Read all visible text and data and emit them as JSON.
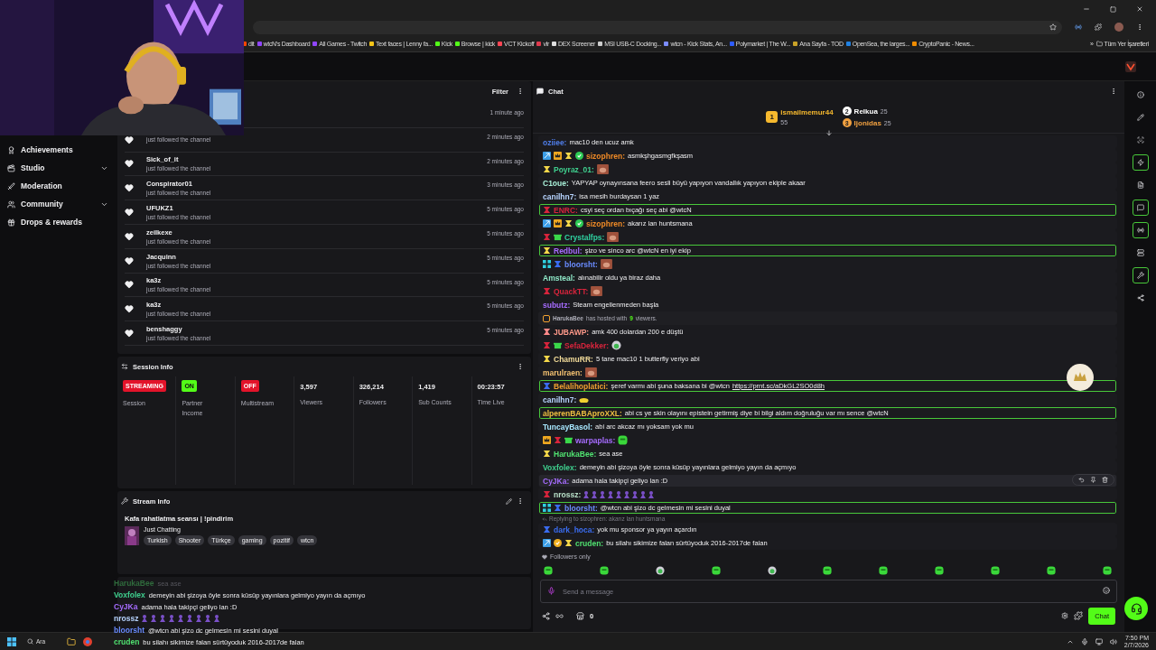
{
  "bookmarks": [
    {
      "label": "dit",
      "color": "#ff4500"
    },
    {
      "label": "wtcN's Dashboard",
      "color": "#9146ff"
    },
    {
      "label": "All Games - Twitch",
      "color": "#9146ff"
    },
    {
      "label": "Text faces | Lenny fa...",
      "color": "#f5c518"
    },
    {
      "label": "Kick",
      "color": "#53fc18"
    },
    {
      "label": "Browse | kick",
      "color": "#53fc18"
    },
    {
      "label": "VCT Kickoff",
      "color": "#ff4655"
    },
    {
      "label": "vlr",
      "color": "#e03a4e"
    },
    {
      "label": "DEX Screener",
      "color": "#dddddd"
    },
    {
      "label": "MSI USB-C Docking...",
      "color": "#cccccc"
    },
    {
      "label": "wtcn - Kick Stats, An...",
      "color": "#7b8cff"
    },
    {
      "label": "Polymarket | The W...",
      "color": "#2e5cff"
    },
    {
      "label": "Ana Sayfa - TOD",
      "color": "#c9a227"
    },
    {
      "label": "OpenSea, the larges...",
      "color": "#2081e2"
    },
    {
      "label": "CryptoPanic - News...",
      "color": "#f08c00"
    }
  ],
  "bookmarks_more": "»",
  "all_bookmarks": "Tüm Yer İşaretleri",
  "sidebar": [
    {
      "label": "Achievements",
      "expandable": false,
      "kind": "trophy"
    },
    {
      "label": "Studio",
      "expandable": true,
      "kind": "studio"
    },
    {
      "label": "Moderation",
      "expandable": false,
      "kind": "sword"
    },
    {
      "label": "Community",
      "expandable": true,
      "kind": "people"
    },
    {
      "label": "Drops & rewards",
      "expandable": false,
      "kind": "gift"
    }
  ],
  "activity": {
    "filter": "Filter",
    "rows": [
      {
        "time": "1 minute ago"
      },
      {
        "text": "just followed the channel",
        "time": "2 minutes ago"
      },
      {
        "name": "Sick_of_it",
        "text": "just followed the channel",
        "time": "2 minutes ago"
      },
      {
        "name": "Conspirator01",
        "text": "just followed the channel",
        "time": "3 minutes ago"
      },
      {
        "name": "UFUKZ1",
        "text": "just followed the channel",
        "time": "5 minutes ago"
      },
      {
        "name": "zeilkexe",
        "text": "just followed the channel",
        "time": "5 minutes ago"
      },
      {
        "name": "Jacquinn",
        "text": "just followed the channel",
        "time": "5 minutes ago"
      },
      {
        "name": "ka3z",
        "text": "just followed the channel",
        "time": "5 minutes ago"
      },
      {
        "name": "ka3z",
        "text": "just followed the channel",
        "time": "5 minutes ago"
      },
      {
        "name": "benshaggy",
        "text": "just followed the channel",
        "time": "5 minutes ago"
      }
    ]
  },
  "session_info": {
    "title": "Session Info",
    "stats": [
      {
        "kind": "status",
        "badge": "STREAMING",
        "color": "#e3132a",
        "label": "Session"
      },
      {
        "kind": "status",
        "badge": "ON",
        "color": "#53fc18",
        "label": "Partner Income"
      },
      {
        "kind": "status",
        "badge": "OFF",
        "color": "#e3132a",
        "label": "Multistream"
      },
      {
        "kind": "number",
        "value": "3,597",
        "label": "Viewers"
      },
      {
        "kind": "number",
        "value": "326,214",
        "label": "Followers"
      },
      {
        "kind": "number",
        "value": "1,419",
        "label": "Sub Counts"
      },
      {
        "kind": "number",
        "value": "00:23:57",
        "label": "Time Live"
      }
    ]
  },
  "stream_info": {
    "title": "Stream Info",
    "stream_title": "Kafa rahatlatma seansı | !pindirim",
    "category": "Just Chatting",
    "tags": [
      "Turkish",
      "Shooter",
      "Türkçe",
      "gaming",
      "pozitif",
      "wtcn"
    ]
  },
  "overlay_chat": [
    {
      "user": "HarukaBee",
      "text": "sea ase",
      "faded": true,
      "color": "#2f6a3c"
    },
    {
      "user": "Voxfolex",
      "text": "demeyin abi şizoya öyle sonra küsüp yayınlara gelmiyo yayın da açmıyo",
      "faded": false,
      "color": "#3fcf8e"
    },
    {
      "user": "CyJKa",
      "text": "adama hala takipçi geliyo lan :D",
      "faded": false,
      "color": "#a66cff"
    },
    {
      "user": "nrossz",
      "faded": false,
      "color": "#b7d4ff"
    },
    {
      "user": "bloorsht",
      "text": "@wtcn abi şizo dc gelmesin mi sesini duyal",
      "faded": false,
      "color": "#6a8cff"
    },
    {
      "user": "cruden",
      "text": "bu silahı sikimize falan sürtüyoduk 2016-2017de falan",
      "faded": false,
      "color": "#50e070"
    }
  ],
  "chat": {
    "title": "Chat",
    "leaders": [
      {
        "rank": "1",
        "name": "ismailmemur44",
        "count": "55",
        "color": "#f5b82e"
      },
      {
        "rank": "2",
        "name": "Relkua",
        "count": "25",
        "color": "#ffffff"
      },
      {
        "rank": "3",
        "name": "Ijonidas",
        "count": "25",
        "color": "#f0a040"
      }
    ],
    "messages": [
      {
        "kind": "text",
        "user": "oziiee:",
        "color": "#4f7de8",
        "text": "mac10 den ucuz amk",
        "highlighted": false,
        "hovered": false
      },
      {
        "kind": "text",
        "user": "sizophren:",
        "color": "#ef8a26",
        "text": "asmkşhgasmgfkşasm",
        "highlighted": false,
        "hovered": false
      },
      {
        "kind": "text",
        "user": "Poyraz_01:",
        "color": "#3fcf8e",
        "highlighted": false,
        "hovered": false
      },
      {
        "kind": "text",
        "user": "C1oue:",
        "color": "#a8efd8",
        "text": "YAPYAP oynayınsana feero sesli büyü yapıyon vandallık yapıyon ekiple akaar",
        "highlighted": false,
        "hovered": false
      },
      {
        "kind": "text",
        "user": "canilhn7:",
        "color": "#b7d4ff",
        "text": "isa mesih burdaysan 1 yaz",
        "highlighted": false,
        "hovered": false
      },
      {
        "kind": "text",
        "user": "ENRC:",
        "color": "#d8243c",
        "text": "csyi seç ordan bıçağı seç abi @wtcN",
        "highlighted": true,
        "hovered": false
      },
      {
        "kind": "text",
        "user": "sizophren:",
        "color": "#ef8a26",
        "text": "akarız lan huntsmana",
        "highlighted": false,
        "hovered": false
      },
      {
        "kind": "text",
        "user": "Crystalfps:",
        "color": "#2fd0a0",
        "highlighted": false,
        "hovered": false
      },
      {
        "kind": "text",
        "user": "Redbul:",
        "color": "#a66cff",
        "text": "şizo ve sinco arc @wtcN en iyi ekip",
        "highlighted": true,
        "hovered": false
      },
      {
        "kind": "text",
        "user": "bloorsht:",
        "color": "#6a8cff",
        "highlighted": false,
        "hovered": false
      },
      {
        "kind": "text",
        "user": "Amsteal:",
        "color": "#8fe8c8",
        "text": "alınabilir oldu ya biraz daha",
        "highlighted": false,
        "hovered": false
      },
      {
        "kind": "text",
        "user": "QuackTT:",
        "color": "#d8243c",
        "highlighted": false,
        "hovered": false
      },
      {
        "kind": "text",
        "user": "subutz:",
        "color": "#a66cff",
        "text": "Steam engellenmeden başla",
        "highlighted": false,
        "hovered": false
      },
      {
        "kind": "host",
        "user": "HarukaBee",
        "text": "has hosted with",
        "count": "9",
        "suffix": "viewers.",
        "highlighted": false,
        "hovered": false
      },
      {
        "kind": "text",
        "user": "JUBAWP:",
        "color": "#ff9a8a",
        "text": "amk 400 dolardan 200 e düştü",
        "highlighted": false,
        "hovered": false
      },
      {
        "kind": "text",
        "user": "SefaDekker:",
        "color": "#d8243c",
        "highlighted": false,
        "hovered": false
      },
      {
        "kind": "text",
        "user": "ChamuRR:",
        "color": "#f3dc9a",
        "text": "5 tane mac10 1 butterfly veriyo abi",
        "highlighted": false,
        "hovered": false
      },
      {
        "kind": "text",
        "user": "marulraen:",
        "color": "#f3c070",
        "highlighted": false,
        "hovered": false
      },
      {
        "kind": "text",
        "user": "Belalihoplatici:",
        "color": "#f0a030",
        "text": "şeref varmı abi şuna baksana bi @wtcn",
        "link": "https://prnt.sc/aDkGL2SO0d8h",
        "highlighted": true,
        "hovered": false
      },
      {
        "kind": "text",
        "user": "canilhn7:",
        "color": "#b7d4ff",
        "highlighted": false,
        "hovered": false
      },
      {
        "kind": "text",
        "user": "alperenBABAproXXL:",
        "color": "#f0c040",
        "text": "abi cs ye skin olayını epistein getirmiş diye bi bilgi aldım doğruluğu var mı sence @wtcN",
        "highlighted": true,
        "hovered": false
      },
      {
        "kind": "text",
        "user": "TuncayBasol:",
        "color": "#a8e8ff",
        "text": "abi arc akcaz mı yoksam yok mu",
        "highlighted": false,
        "hovered": false
      },
      {
        "kind": "text",
        "user": "warpaplas:",
        "color": "#a66cff",
        "highlighted": false,
        "hovered": false
      },
      {
        "kind": "text",
        "user": "HarukaBee:",
        "color": "#50e070",
        "text": "sea ase",
        "highlighted": false,
        "hovered": false
      },
      {
        "kind": "text",
        "user": "Voxfolex:",
        "color": "#3fcf8e",
        "text": "demeyin abi şizoya öyle sonra küsüp yayınlara gelmiyo yayın da açmıyo",
        "highlighted": false,
        "hovered": false
      },
      {
        "kind": "text",
        "user": "CyJKa:",
        "color": "#a66cff",
        "text": "adama hala takipçi geliyo lan :D",
        "highlighted": false,
        "hovered": true
      },
      {
        "kind": "text",
        "user": "nrossz:",
        "color": "#b8e0c8",
        "highlighted": false,
        "hovered": false
      },
      {
        "kind": "text",
        "user": "bloorsht:",
        "color": "#6a8cff",
        "text": "@wtcn abi şizo dc gelmesin mi sesini duyal",
        "highlighted": true,
        "hovered": false
      },
      {
        "kind": "reply",
        "reply_to": "Replying to sizophren: akarız lan huntsmana",
        "user": "dark_hoca:",
        "color": "#3a6cf0",
        "text": "yok mu sponsor ya yayın açardın",
        "highlighted": false,
        "hovered": false
      },
      {
        "kind": "text",
        "user": "cruden:",
        "color": "#50e070",
        "text": "bu silahı sikimize falan sürtüyoduk 2016-2017de falan",
        "highlighted": false,
        "hovered": false
      }
    ],
    "followers_only": "Followers only",
    "input": {
      "placeholder": "Send a message"
    },
    "store_count": "0",
    "send_button": "Chat"
  },
  "rail": [
    {
      "kind": "info",
      "highlighted": false
    },
    {
      "kind": "edit",
      "highlighted": false
    },
    {
      "kind": "scan",
      "highlighted": false
    },
    {
      "kind": "bolt",
      "highlighted": true
    },
    {
      "kind": "notes",
      "highlighted": false
    },
    {
      "kind": "chat",
      "highlighted": true
    },
    {
      "kind": "broadcast",
      "highlighted": true
    },
    {
      "kind": "server",
      "highlighted": false
    },
    {
      "kind": "wrench",
      "highlighted": true
    },
    {
      "kind": "share",
      "highlighted": false
    }
  ],
  "taskbar": {
    "search": "Ara",
    "time": "7:50 PM",
    "date": "2/7/2026"
  }
}
